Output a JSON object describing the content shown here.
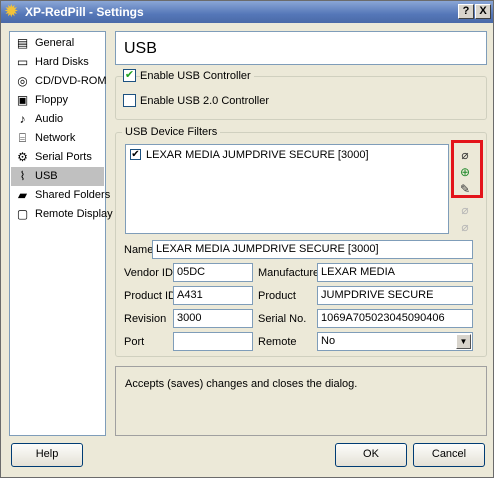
{
  "window": {
    "title": "XP-RedPill - Settings",
    "help_glyph": "?",
    "close_glyph": "X"
  },
  "sidebar": {
    "items": [
      {
        "label": "General",
        "icon": "general-icon"
      },
      {
        "label": "Hard Disks",
        "icon": "hard-disk-icon"
      },
      {
        "label": "CD/DVD-ROM",
        "icon": "cd-icon"
      },
      {
        "label": "Floppy",
        "icon": "floppy-icon"
      },
      {
        "label": "Audio",
        "icon": "audio-icon"
      },
      {
        "label": "Network",
        "icon": "network-icon"
      },
      {
        "label": "Serial Ports",
        "icon": "serial-port-icon"
      },
      {
        "label": "USB",
        "icon": "usb-icon",
        "selected": true
      },
      {
        "label": "Shared Folders",
        "icon": "shared-folder-icon"
      },
      {
        "label": "Remote Display",
        "icon": "remote-display-icon"
      }
    ]
  },
  "header": {
    "title": "USB"
  },
  "controller": {
    "enable_usb_label": "Enable USB Controller",
    "enable_usb_checked": true,
    "enable_usb2_label": "Enable USB 2.0 Controller",
    "enable_usb2_checked": false
  },
  "filters": {
    "group_label": "USB Device Filters",
    "entries": [
      {
        "label": "LEXAR MEDIA JUMPDRIVE SECURE [3000]",
        "checked": true
      }
    ],
    "icons": [
      {
        "name": "add-empty-filter-icon",
        "enabled": true
      },
      {
        "name": "add-filter-from-device-icon",
        "enabled": true
      },
      {
        "name": "edit-filter-icon",
        "enabled": true
      },
      {
        "name": "move-filter-up-icon",
        "enabled": false
      },
      {
        "name": "move-filter-down-icon",
        "enabled": false
      }
    ]
  },
  "form": {
    "name_label": "Name",
    "name_value": "LEXAR MEDIA JUMPDRIVE SECURE [3000]",
    "vendor_label": "Vendor ID",
    "vendor_value": "05DC",
    "manufacturer_label": "Manufacturer",
    "manufacturer_value": "LEXAR MEDIA",
    "product_id_label": "Product ID",
    "product_id_value": "A431",
    "product_label": "Product",
    "product_value": "JUMPDRIVE SECURE",
    "revision_label": "Revision",
    "revision_value": "3000",
    "serial_label": "Serial No.",
    "serial_value": "1069A705023045090406",
    "port_label": "Port",
    "port_value": "",
    "remote_label": "Remote",
    "remote_value": "No"
  },
  "description": "Accepts (saves) changes and closes the dialog.",
  "buttons": {
    "help": "Help",
    "ok": "OK",
    "cancel": "Cancel"
  },
  "colors": {
    "highlight_box": "#e3141b",
    "title_bar": "#5577b8",
    "check": "#21a121"
  }
}
